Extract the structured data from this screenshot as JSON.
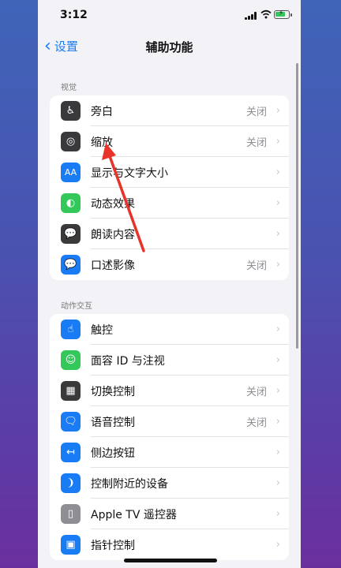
{
  "status_bar": {
    "time": "3:12"
  },
  "nav": {
    "back_label": "设置",
    "title": "辅助功能"
  },
  "sections": [
    {
      "header": "视觉",
      "items": [
        {
          "label": "旁白",
          "value": "关闭",
          "icon": "voiceover-icon",
          "color": "#3a3a3c"
        },
        {
          "label": "缩放",
          "value": "关闭",
          "icon": "zoom-icon",
          "color": "#3a3a3c"
        },
        {
          "label": "显示与文字大小",
          "value": "",
          "icon": "text-size-icon",
          "color": "#1a7cf5"
        },
        {
          "label": "动态效果",
          "value": "",
          "icon": "motion-icon",
          "color": "#34c759"
        },
        {
          "label": "朗读内容",
          "value": "",
          "icon": "spoken-content-icon",
          "color": "#3a3a3c"
        },
        {
          "label": "口述影像",
          "value": "关闭",
          "icon": "audio-description-icon",
          "color": "#1a7cf5"
        }
      ]
    },
    {
      "header": "动作交互",
      "items": [
        {
          "label": "触控",
          "value": "",
          "icon": "touch-icon",
          "color": "#1a7cf5"
        },
        {
          "label": "面容 ID 与注视",
          "value": "",
          "icon": "face-id-icon",
          "color": "#34c759"
        },
        {
          "label": "切换控制",
          "value": "关闭",
          "icon": "switch-control-icon",
          "color": "#3a3a3c"
        },
        {
          "label": "语音控制",
          "value": "关闭",
          "icon": "voice-control-icon",
          "color": "#1a7cf5"
        },
        {
          "label": "侧边按钮",
          "value": "",
          "icon": "side-button-icon",
          "color": "#1a7cf5"
        },
        {
          "label": "控制附近的设备",
          "value": "",
          "icon": "nearby-devices-icon",
          "color": "#1a7cf5"
        },
        {
          "label": "Apple TV 遥控器",
          "value": "",
          "icon": "apple-tv-remote-icon",
          "color": "#8e8e93"
        },
        {
          "label": "指针控制",
          "value": "",
          "icon": "pointer-control-icon",
          "color": "#1a7cf5"
        }
      ]
    }
  ],
  "annotation": {
    "arrow_color": "#e8332a"
  }
}
